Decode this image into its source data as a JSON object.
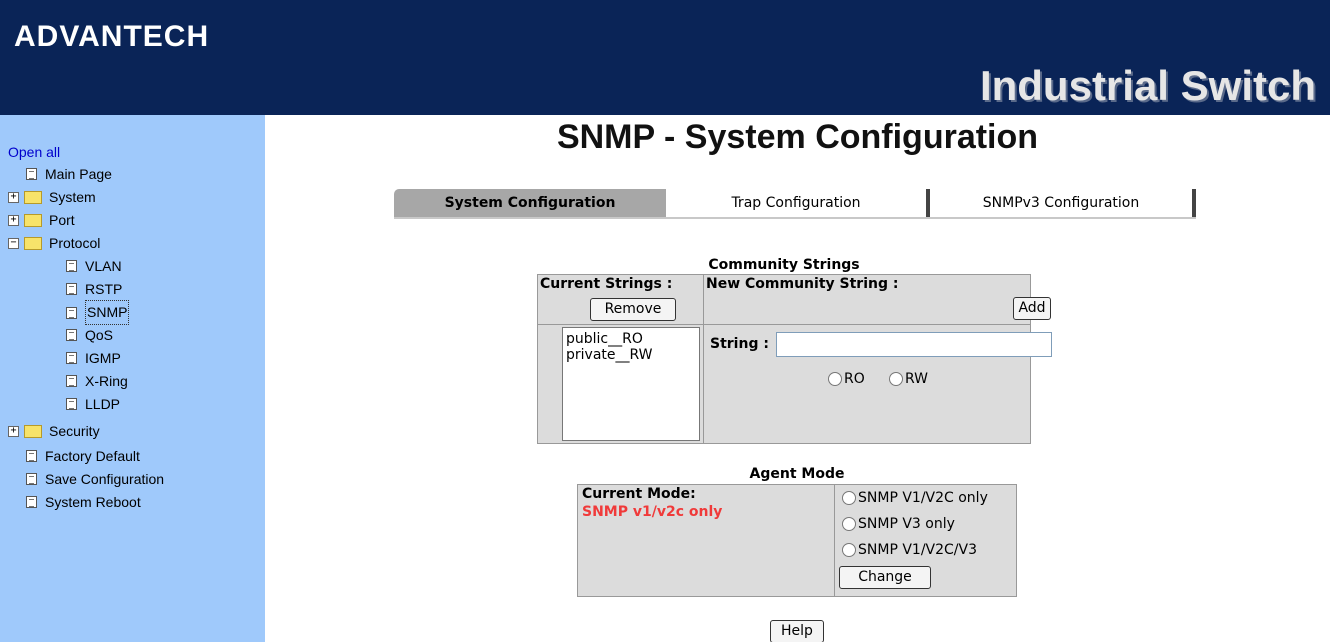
{
  "header": {
    "logo": "ADVANTECH",
    "product": "Industrial Switch"
  },
  "sidebar": {
    "open_all": "Open all",
    "items": [
      {
        "label": "Main Page",
        "icon": "doc-icon"
      },
      {
        "label": "System",
        "icon": "folder-icon"
      },
      {
        "label": "Port",
        "icon": "folder-icon"
      },
      {
        "label": "Protocol",
        "icon": "folder-open-icon"
      },
      {
        "label": "VLAN",
        "icon": "doc-icon"
      },
      {
        "label": "RSTP",
        "icon": "doc-icon"
      },
      {
        "label": "SNMP",
        "icon": "doc-icon"
      },
      {
        "label": "QoS",
        "icon": "doc-icon"
      },
      {
        "label": "IGMP",
        "icon": "doc-icon"
      },
      {
        "label": "X-Ring",
        "icon": "doc-icon"
      },
      {
        "label": "LLDP",
        "icon": "doc-icon"
      },
      {
        "label": "Security",
        "icon": "folder-icon"
      },
      {
        "label": "Factory Default",
        "icon": "doc-icon"
      },
      {
        "label": "Save Configuration",
        "icon": "doc-icon"
      },
      {
        "label": "System Reboot",
        "icon": "doc-icon"
      }
    ]
  },
  "main": {
    "title": "SNMP - System Configuration",
    "tabs": [
      {
        "label": "System Configuration",
        "active": true
      },
      {
        "label": "Trap Configuration",
        "active": false
      },
      {
        "label": "SNMPv3 Configuration",
        "active": false
      }
    ],
    "community": {
      "title": "Community Strings",
      "current_label": "Current Strings :",
      "remove_label": "Remove",
      "new_label": "New Community String :",
      "add_label": "Add",
      "strings": [
        "public__RO",
        "private__RW"
      ],
      "string_label": "String :",
      "string_value": "",
      "ro_label": "RO",
      "rw_label": "RW"
    },
    "agent": {
      "title": "Agent Mode",
      "current_mode_label": "Current Mode:",
      "current_mode_value": "SNMP v1/v2c only",
      "options": [
        "SNMP V1/V2C only",
        "SNMP V3 only",
        "SNMP V1/V2C/V3"
      ],
      "change_label": "Change"
    },
    "help_label": "Help"
  },
  "colors": {
    "header_bg": "#0a2457",
    "sidebar_bg": "#9fc9fb",
    "current_mode": "#f03a3a"
  }
}
